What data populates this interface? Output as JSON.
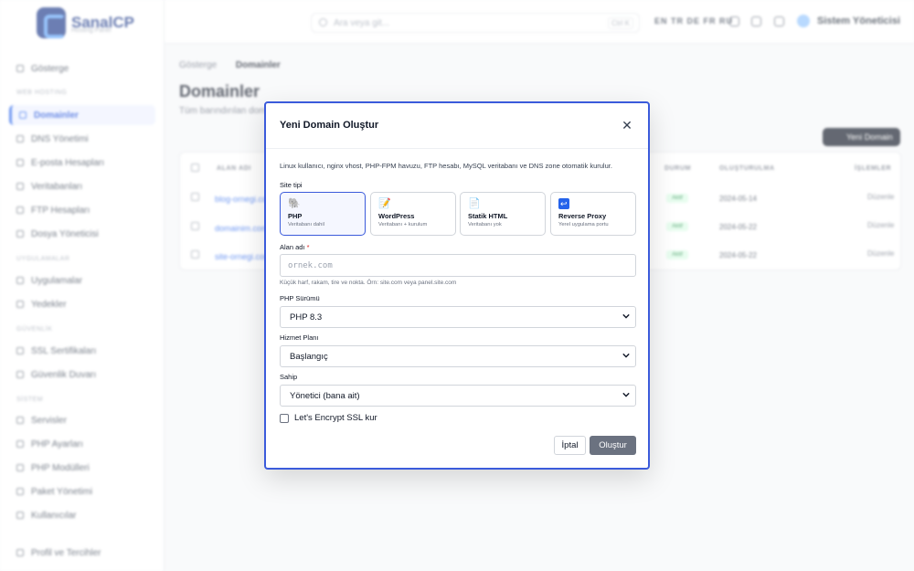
{
  "app": {
    "logo_text": "SanalCP",
    "logo_sub": "Hosting Panel"
  },
  "sidebar": {
    "items": [
      {
        "label": "Gösterge"
      },
      {
        "label": "Domainler"
      },
      {
        "label": "DNS Yönetimi"
      },
      {
        "label": "E-posta Hesapları"
      },
      {
        "label": "Veritabanları"
      },
      {
        "label": "FTP Hesapları"
      },
      {
        "label": "Dosya Yöneticisi"
      },
      {
        "label": "Uygulamalar"
      },
      {
        "label": "Yedekler"
      },
      {
        "label": "SSL Sertifikaları"
      },
      {
        "label": "Güvenlik Duvarı"
      },
      {
        "label": "Servisler"
      },
      {
        "label": "PHP Ayarları"
      },
      {
        "label": "PHP Modülleri"
      },
      {
        "label": "Paket Yönetimi"
      },
      {
        "label": "Kullanıcılar"
      },
      {
        "label": "Profil ve Tercihler"
      }
    ],
    "sections": [
      "WEB HOSTING",
      "UYGULAMALAR",
      "GÜVENLİK",
      "SİSTEM"
    ]
  },
  "topbar": {
    "search_placeholder": "Ara veya git...",
    "shortcut": "Ctrl K",
    "languages": "EN TR DE FR RU",
    "user_name": "Sistem Yöneticisi"
  },
  "page": {
    "breadcrumb_root": "Gösterge",
    "breadcrumb_current": "Domainler",
    "title": "Domainler",
    "subtitle": "Tüm barındırılan domainleri yönetin",
    "new_button": "Yeni Domain",
    "table_headers": [
      "ALAN ADI",
      "DURUM",
      "OLUŞTURULMA",
      "İŞLEMLER"
    ],
    "rows": [
      {
        "name": "blog-ornegi.com",
        "status": "Aktif",
        "date": "2024-05-14",
        "action": "Düzenle"
      },
      {
        "name": "domainim.com",
        "status": "Aktif",
        "date": "2024-05-22",
        "action": "Düzenle"
      },
      {
        "name": "site-ornegi.com",
        "status": "Aktif",
        "date": "2024-05-22",
        "action": "Düzenle"
      }
    ]
  },
  "modal": {
    "title": "Yeni Domain Oluştur",
    "intro": "Linux kullanıcı, nginx vhost, PHP-FPM havuzu, FTP hesabı, MySQL veritabanı ve DNS zone otomatik kurulur.",
    "site_type_label": "Site tipi",
    "site_types": [
      {
        "icon": "elephant-icon",
        "glyph": "🐘",
        "title": "PHP",
        "desc": "Veritabanı dahil"
      },
      {
        "icon": "memo-icon",
        "glyph": "📝",
        "title": "WordPress",
        "desc": "Veritabanı + kurulum"
      },
      {
        "icon": "page-icon",
        "glyph": "📄",
        "title": "Statik HTML",
        "desc": "Veritabanı yok"
      },
      {
        "icon": "reverse-arrow-icon",
        "glyph": "↩",
        "title": "Reverse Proxy",
        "desc": "Yerel uygulama portu"
      }
    ],
    "domain_label": "Alan adı",
    "domain_required": "*",
    "domain_placeholder": "ornek.com",
    "domain_value": "",
    "domain_hint": "Küçük harf, rakam, tire ve nokta. Örn: site.com veya panel.site.com",
    "php_label": "PHP Sürümü",
    "php_value": "PHP 8.3",
    "plan_label": "Hizmet Planı",
    "plan_value": "Başlangıç",
    "owner_label": "Sahip",
    "owner_value": "Yönetici (bana ait)",
    "ssl_label": "Let's Encrypt SSL kur",
    "ssl_checked": false,
    "cancel_label": "İptal",
    "create_label": "Oluştur"
  },
  "colors": {
    "accent": "#3b5bdb",
    "create_button": "#6b7280",
    "status_active": "#15803d"
  }
}
